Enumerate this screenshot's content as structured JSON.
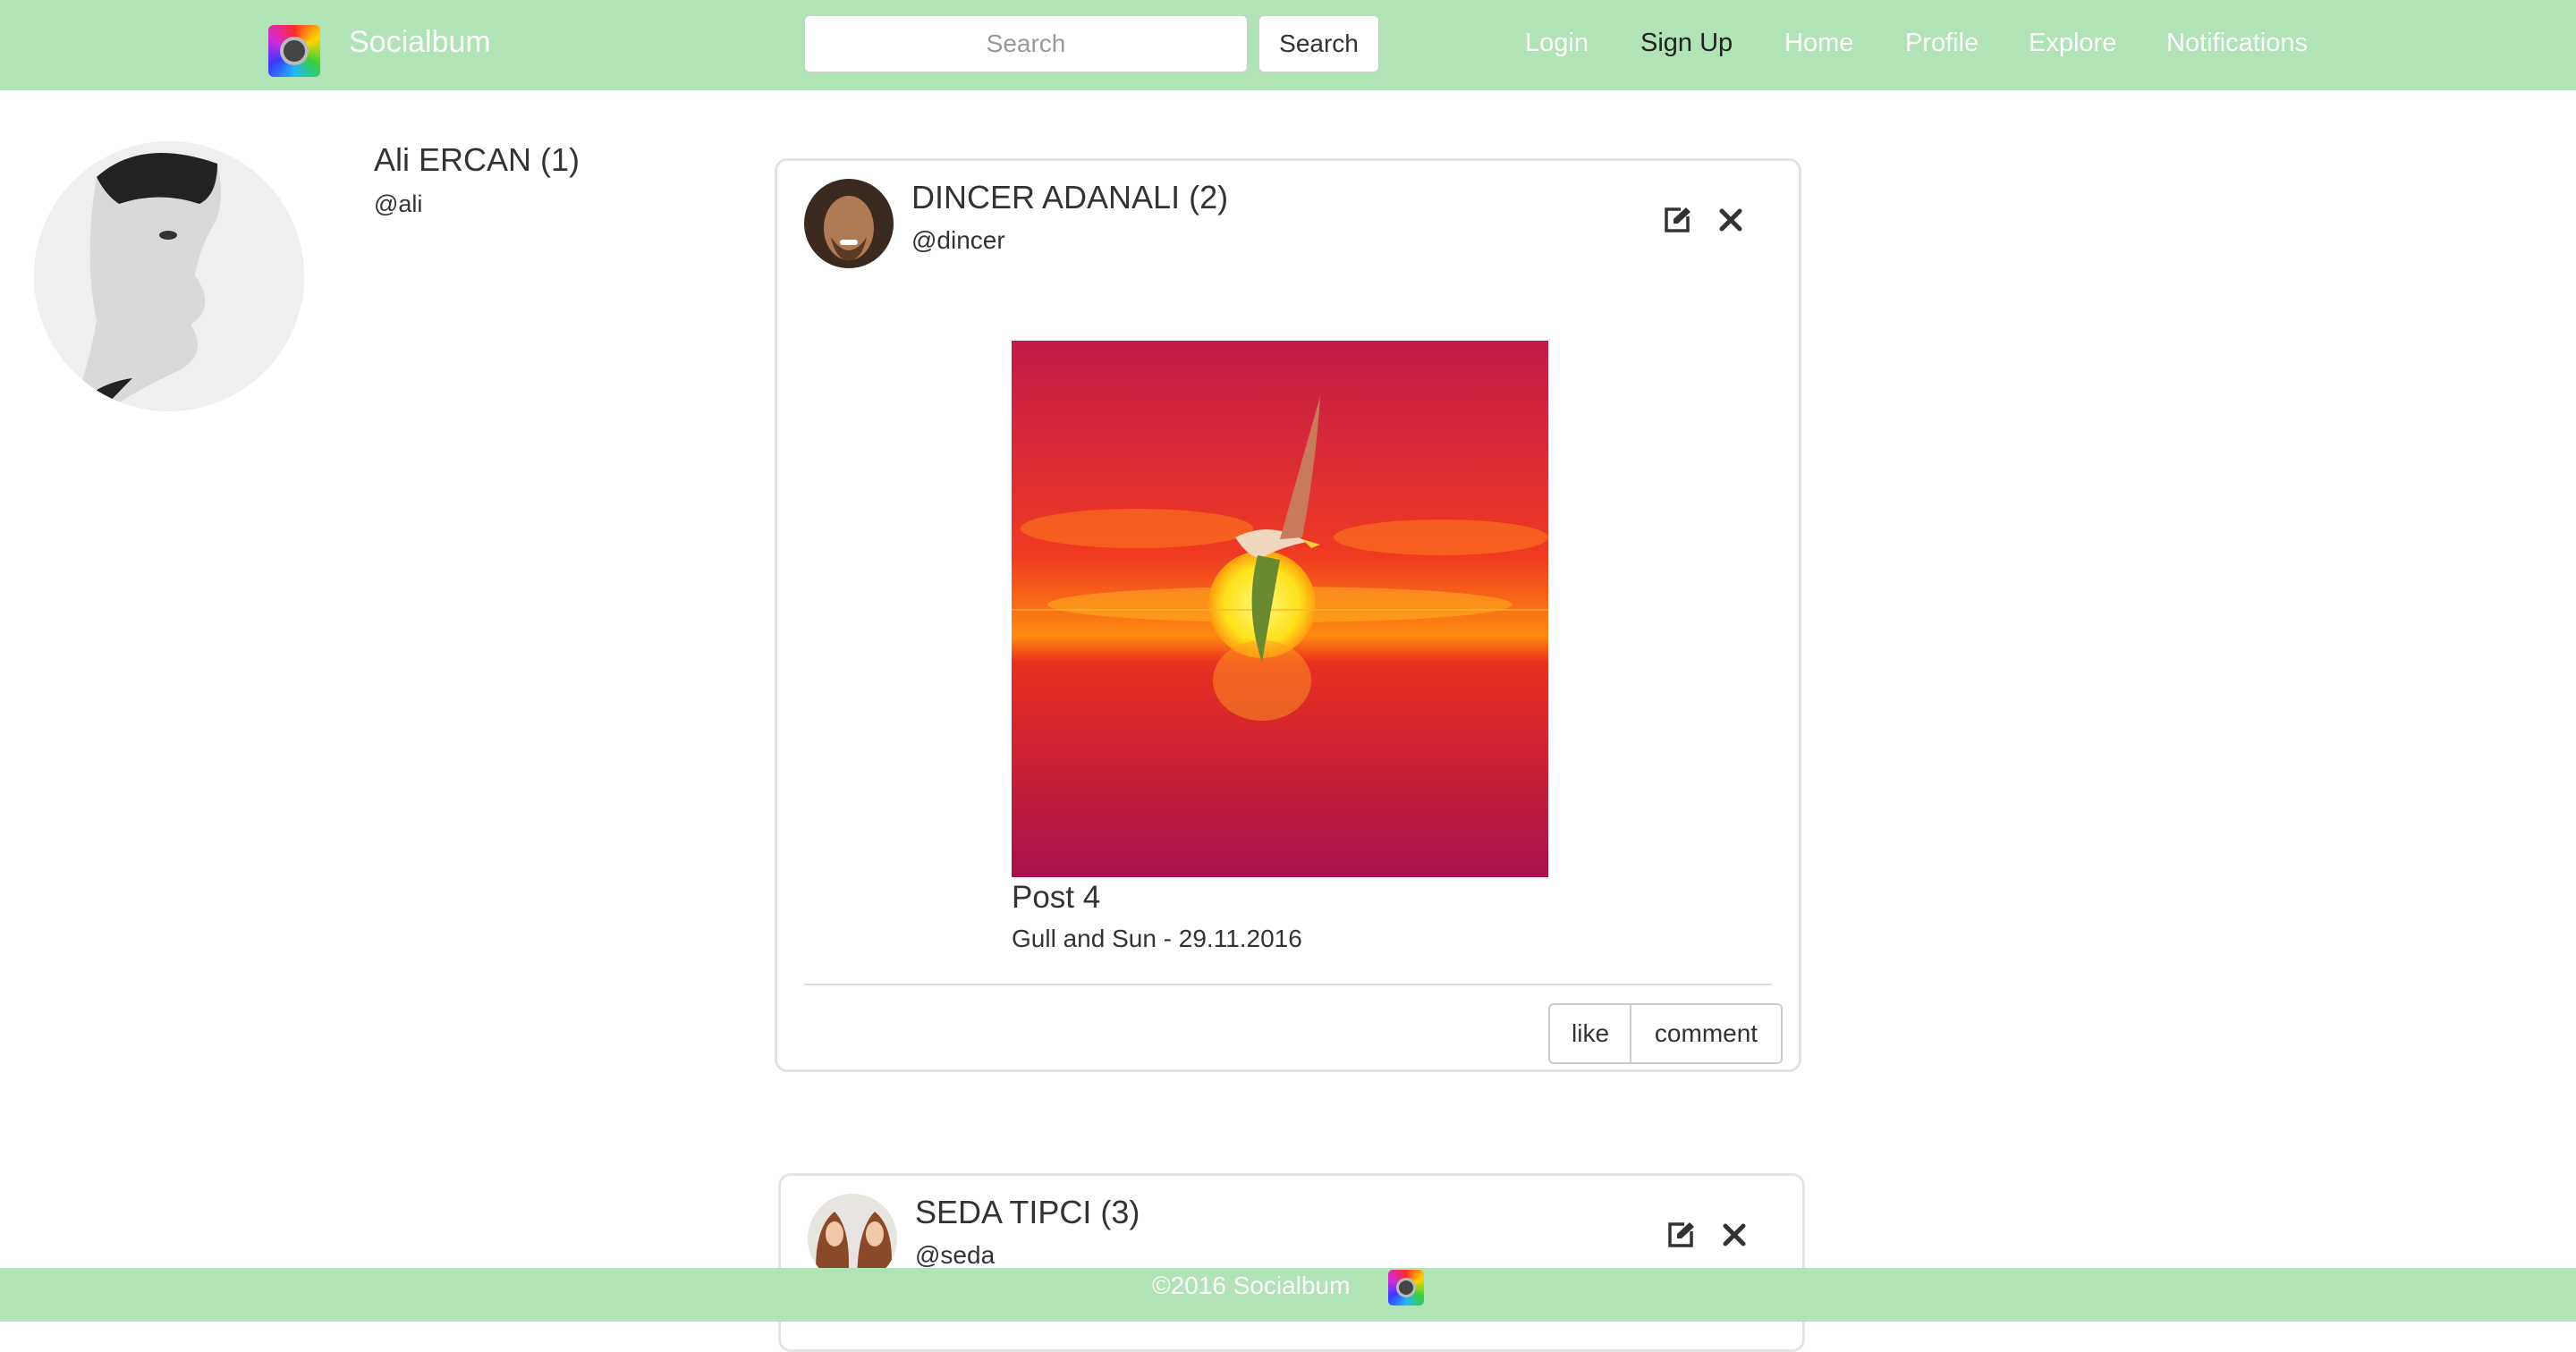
{
  "navbar": {
    "brand": "Socialbum",
    "search_placeholder": "Search",
    "search_button": "Search",
    "links": [
      "Login",
      "Sign Up",
      "Home",
      "Profile",
      "Explore",
      "Notifications"
    ]
  },
  "profile": {
    "name": "Ali ERCAN (1)",
    "handle": "@ali"
  },
  "posts": [
    {
      "author": "DINCER ADANALI (2)",
      "handle": "@dincer",
      "title": "Post 4",
      "caption": "Gull and Sun - 29.11.2016",
      "like_label": "like",
      "comment_label": "comment"
    },
    {
      "author": "SEDA TIPCI (3)",
      "handle": "@seda"
    }
  ],
  "footer": {
    "text": "©2016 Socialbum"
  },
  "colors": {
    "navbar_bg": "#b0e3b5",
    "footer_bg": "#b0e3b5"
  },
  "icons": {
    "edit": "edit-icon",
    "delete": "close-icon"
  }
}
